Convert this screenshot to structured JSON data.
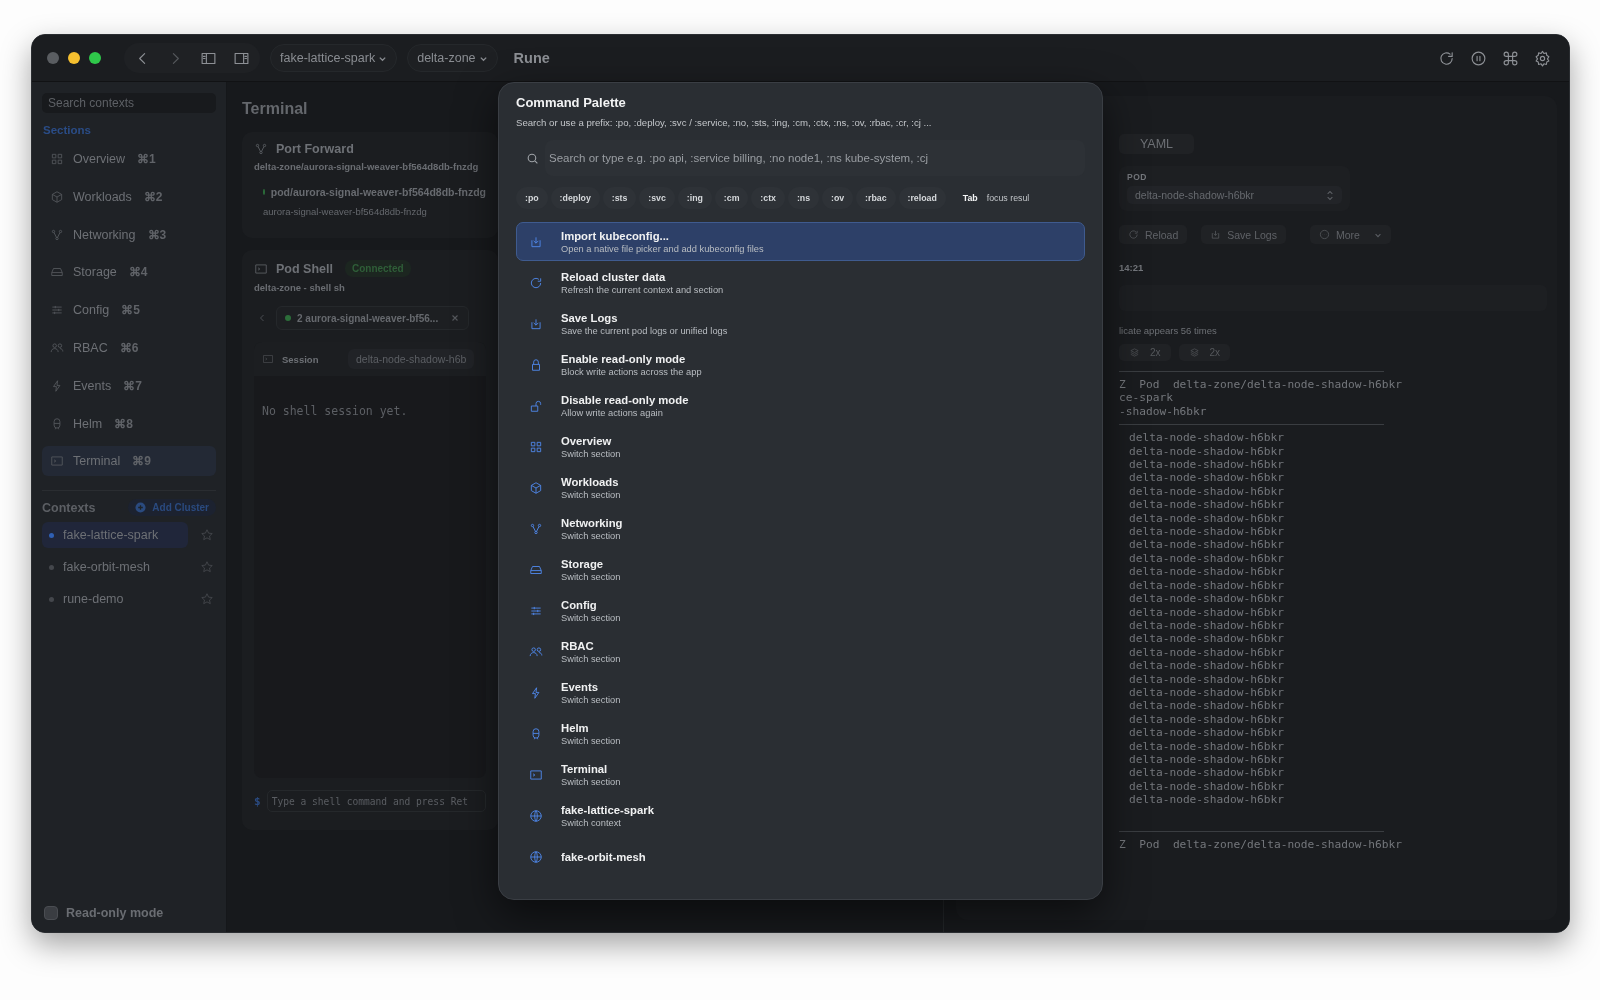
{
  "titlebar": {
    "context_picker": "fake-lattice-spark",
    "namespace_picker": "delta-zone",
    "app_title": "Rune"
  },
  "sidebar": {
    "search_placeholder": "Search contexts",
    "sections_label": "Sections",
    "sections": [
      {
        "label": "Overview",
        "shortcut": "⌘1",
        "kind": "grid",
        "selected": false
      },
      {
        "label": "Workloads",
        "shortcut": "⌘2",
        "kind": "cube",
        "selected": false
      },
      {
        "label": "Networking",
        "shortcut": "⌘3",
        "kind": "network",
        "selected": false
      },
      {
        "label": "Storage",
        "shortcut": "⌘4",
        "kind": "drive",
        "selected": false
      },
      {
        "label": "Config",
        "shortcut": "⌘5",
        "kind": "sliders",
        "selected": false
      },
      {
        "label": "RBAC",
        "shortcut": "⌘6",
        "kind": "users",
        "selected": false
      },
      {
        "label": "Events",
        "shortcut": "⌘7",
        "kind": "bolt",
        "selected": false
      },
      {
        "label": "Helm",
        "shortcut": "⌘8",
        "kind": "helm",
        "selected": false
      },
      {
        "label": "Terminal",
        "shortcut": "⌘9",
        "kind": "terminal",
        "selected": true
      }
    ],
    "contexts_label": "Contexts",
    "add_cluster": "Add Cluster",
    "contexts": [
      {
        "name": "fake-lattice-spark",
        "selected": true
      },
      {
        "name": "fake-orbit-mesh",
        "selected": false
      },
      {
        "name": "rune-demo",
        "selected": false
      }
    ],
    "read_only": {
      "label": "Read-only mode",
      "checked": false
    }
  },
  "terminal_panel": {
    "title": "Terminal",
    "port_forward": {
      "title": "Port Forward",
      "target": "delta-zone/aurora-signal-weaver-bf564d8db-fnzdg",
      "pod": "pod/aurora-signal-weaver-bf564d8db-fnzdg",
      "pod_detail": "aurora-signal-weaver-bf564d8db-fnzdg"
    },
    "pod_shell": {
      "title": "Pod Shell",
      "status": "Connected",
      "subtitle": "delta-zone - shell sh",
      "session_tab": "2 aurora-signal-weaver-bf56...",
      "session_label": "Session",
      "session_value": "delta-node-shadow-h6b",
      "output": "No shell session yet.",
      "prompt": "$",
      "input_placeholder": "Type a shell command and press Ret"
    }
  },
  "logs_panel": {
    "tabs": [
      {
        "label": "YAML",
        "selected": false
      }
    ],
    "pod_label": "POD",
    "pod_value": "delta-node-shadow-h6bkr",
    "buttons": [
      {
        "label": "Reload",
        "kind": "reload"
      },
      {
        "label": "Save Logs",
        "kind": "import"
      },
      {
        "label": "More",
        "kind": "more"
      }
    ],
    "time": "14:21",
    "duplicate_note": "licate appears 56 times",
    "chips": [
      "2x",
      "2x"
    ],
    "blocks": [
      {
        "header": "Z  Pod  delta-zone/delta-node-shadow-h6bkr",
        "meta": [
          "ce-spark",
          "-shadow-h6bkr"
        ],
        "lines": [
          "delta-node-shadow-h6bkr",
          "delta-node-shadow-h6bkr",
          "delta-node-shadow-h6bkr",
          "delta-node-shadow-h6bkr",
          "delta-node-shadow-h6bkr",
          "delta-node-shadow-h6bkr",
          "delta-node-shadow-h6bkr",
          "delta-node-shadow-h6bkr",
          "delta-node-shadow-h6bkr",
          "delta-node-shadow-h6bkr",
          "delta-node-shadow-h6bkr",
          "delta-node-shadow-h6bkr",
          "delta-node-shadow-h6bkr",
          "delta-node-shadow-h6bkr",
          "delta-node-shadow-h6bkr",
          "delta-node-shadow-h6bkr",
          "delta-node-shadow-h6bkr",
          "delta-node-shadow-h6bkr",
          "delta-node-shadow-h6bkr",
          "delta-node-shadow-h6bkr",
          "delta-node-shadow-h6bkr",
          "delta-node-shadow-h6bkr",
          "delta-node-shadow-h6bkr",
          "delta-node-shadow-h6bkr",
          "delta-node-shadow-h6bkr",
          "delta-node-shadow-h6bkr",
          "delta-node-shadow-h6bkr",
          "delta-node-shadow-h6bkr"
        ]
      },
      {
        "header": "Z  Pod  delta-zone/delta-node-shadow-h6bkr"
      }
    ]
  },
  "command_palette": {
    "title": "Command Palette",
    "hint": "Search or use a prefix: :po, :deploy, :svc / :service, :no, :sts, :ing, :cm, :ctx, :ns, :ov, :rbac, :cr, :cj ...",
    "placeholder": "Search or type e.g. :po api, :service billing, :no node1, :ns kube-system, :cj",
    "prefixes": [
      ":po",
      ":deploy",
      ":sts",
      ":svc",
      ":ing",
      ":cm",
      ":ctx",
      ":ns",
      ":ov",
      ":rbac",
      ":reload"
    ],
    "key_hint": {
      "key": "Tab",
      "text": "focus resul"
    },
    "items": [
      {
        "title": "Import kubeconfig...",
        "subtitle": "Open a native file picker and add kubeconfig files",
        "kind": "import",
        "selected": true
      },
      {
        "title": "Reload cluster data",
        "subtitle": "Refresh the current context and section",
        "kind": "reload",
        "selected": false
      },
      {
        "title": "Save Logs",
        "subtitle": "Save the current pod logs or unified logs",
        "kind": "import",
        "selected": false
      },
      {
        "title": "Enable read-only mode",
        "subtitle": "Block write actions across the app",
        "kind": "lock",
        "selected": false
      },
      {
        "title": "Disable read-only mode",
        "subtitle": "Allow write actions again",
        "kind": "unlock",
        "selected": false
      },
      {
        "title": "Overview",
        "subtitle": "Switch section",
        "kind": "grid",
        "selected": false
      },
      {
        "title": "Workloads",
        "subtitle": "Switch section",
        "kind": "cube",
        "selected": false
      },
      {
        "title": "Networking",
        "subtitle": "Switch section",
        "kind": "network",
        "selected": false
      },
      {
        "title": "Storage",
        "subtitle": "Switch section",
        "kind": "drive",
        "selected": false
      },
      {
        "title": "Config",
        "subtitle": "Switch section",
        "kind": "sliders",
        "selected": false
      },
      {
        "title": "RBAC",
        "subtitle": "Switch section",
        "kind": "users",
        "selected": false
      },
      {
        "title": "Events",
        "subtitle": "Switch section",
        "kind": "bolt",
        "selected": false
      },
      {
        "title": "Helm",
        "subtitle": "Switch section",
        "kind": "helm",
        "selected": false
      },
      {
        "title": "Terminal",
        "subtitle": "Switch section",
        "kind": "terminal",
        "selected": false
      },
      {
        "title": "fake-lattice-spark",
        "subtitle": "Switch context",
        "kind": "globe",
        "selected": false
      },
      {
        "title": "fake-orbit-mesh",
        "kind": "globe",
        "selected": false
      }
    ]
  }
}
